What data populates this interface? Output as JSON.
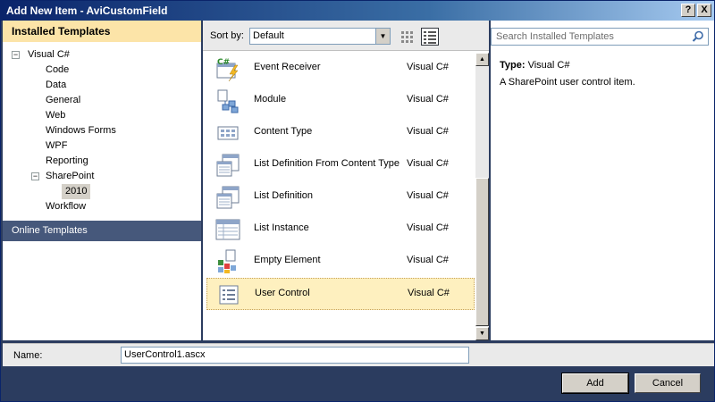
{
  "window": {
    "title": "Add New Item - AviCustomField",
    "help_btn": "?",
    "close_btn": "X"
  },
  "left": {
    "header": "Installed Templates",
    "tree": [
      {
        "label": "Visual C#",
        "expander": "−"
      },
      {
        "label": "Code"
      },
      {
        "label": "Data"
      },
      {
        "label": "General"
      },
      {
        "label": "Web"
      },
      {
        "label": "Windows Forms"
      },
      {
        "label": "WPF"
      },
      {
        "label": "Reporting"
      },
      {
        "label": "SharePoint",
        "expander": "−"
      },
      {
        "label": "2010",
        "selected": true
      },
      {
        "label": "Workflow"
      }
    ],
    "online": "Online Templates"
  },
  "middle": {
    "sort_label": "Sort by:",
    "sort_value": "Default",
    "items": [
      {
        "name": "Event Receiver",
        "lang": "Visual C#",
        "icon": "event-receiver-icon"
      },
      {
        "name": "Module",
        "lang": "Visual C#",
        "icon": "module-icon"
      },
      {
        "name": "Content Type",
        "lang": "Visual C#",
        "icon": "content-type-icon"
      },
      {
        "name": "List Definition From Content Type",
        "lang": "Visual C#",
        "icon": "list-definition-icon"
      },
      {
        "name": "List Definition",
        "lang": "Visual C#",
        "icon": "list-definition-icon"
      },
      {
        "name": "List Instance",
        "lang": "Visual C#",
        "icon": "list-instance-icon"
      },
      {
        "name": "Empty Element",
        "lang": "Visual C#",
        "icon": "empty-element-icon"
      },
      {
        "name": "User Control",
        "lang": "Visual C#",
        "icon": "user-control-icon",
        "selected": true
      }
    ]
  },
  "right": {
    "search_placeholder": "Search Installed Templates",
    "type_label": "Type:",
    "type_value": "Visual C#",
    "description": "A SharePoint user control item."
  },
  "footer": {
    "name_label": "Name:",
    "name_value": "UserControl1.ascx",
    "add_label": "Add",
    "cancel_label": "Cancel"
  }
}
